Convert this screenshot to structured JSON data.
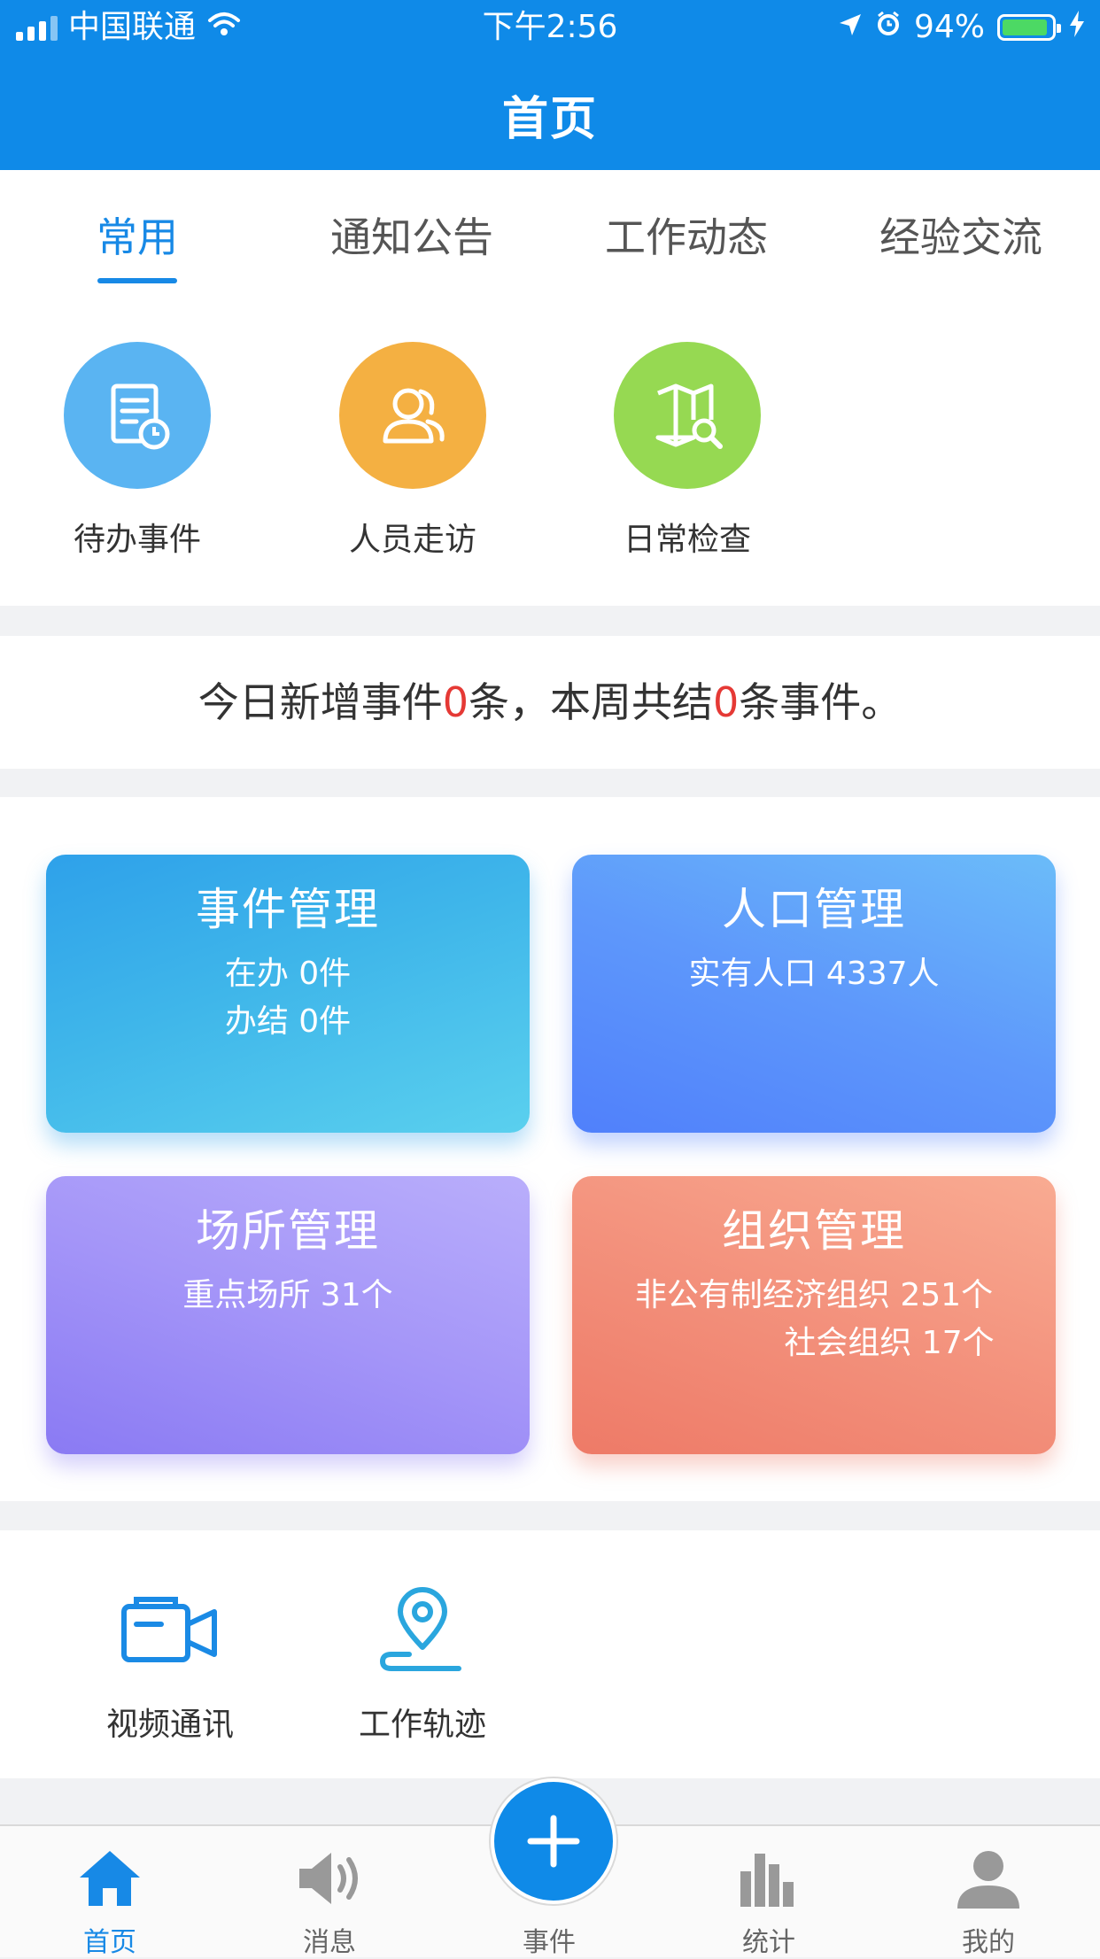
{
  "status_bar": {
    "carrier": "中国联通",
    "time": "下午2:56",
    "battery": "94%"
  },
  "header": {
    "title": "首页"
  },
  "tabs": [
    {
      "label": "常用",
      "active": true
    },
    {
      "label": "通知公告",
      "active": false
    },
    {
      "label": "工作动态",
      "active": false
    },
    {
      "label": "经验交流",
      "active": false
    }
  ],
  "quick_actions": [
    {
      "label": "待办事件",
      "icon": "document-clock-icon",
      "color": "#5ab4f2"
    },
    {
      "label": "人员走访",
      "icon": "people-icon",
      "color": "#f4b042"
    },
    {
      "label": "日常检查",
      "icon": "map-search-icon",
      "color": "#96d952"
    }
  ],
  "summary": {
    "prefix": "今日新增事件",
    "new_count": "0",
    "middle": "条，本周共结",
    "closed_count": "0",
    "suffix": "条事件。"
  },
  "cards": [
    {
      "title": "事件管理",
      "lines": [
        "在办  0件",
        "办结  0件"
      ]
    },
    {
      "title": "人口管理",
      "lines": [
        "实有人口  4337人"
      ]
    },
    {
      "title": "场所管理",
      "lines": [
        "重点场所  31个"
      ]
    },
    {
      "title": "组织管理",
      "lines": [
        "非公有制经济组织  251个",
        "社会组织  17个"
      ]
    }
  ],
  "tools": [
    {
      "label": "视频通讯",
      "icon": "video-call-icon"
    },
    {
      "label": "工作轨迹",
      "icon": "location-pin-icon"
    }
  ],
  "tabbar": [
    {
      "label": "首页",
      "icon": "home-icon",
      "active": true
    },
    {
      "label": "消息",
      "icon": "speaker-icon",
      "active": false
    },
    {
      "label": "事件",
      "icon": "plus-icon",
      "active": false
    },
    {
      "label": "统计",
      "icon": "bar-chart-icon",
      "active": false
    },
    {
      "label": "我的",
      "icon": "user-icon",
      "active": false
    }
  ],
  "colors": {
    "primary": "#0f8ae8",
    "highlight_number": "#e53935"
  }
}
